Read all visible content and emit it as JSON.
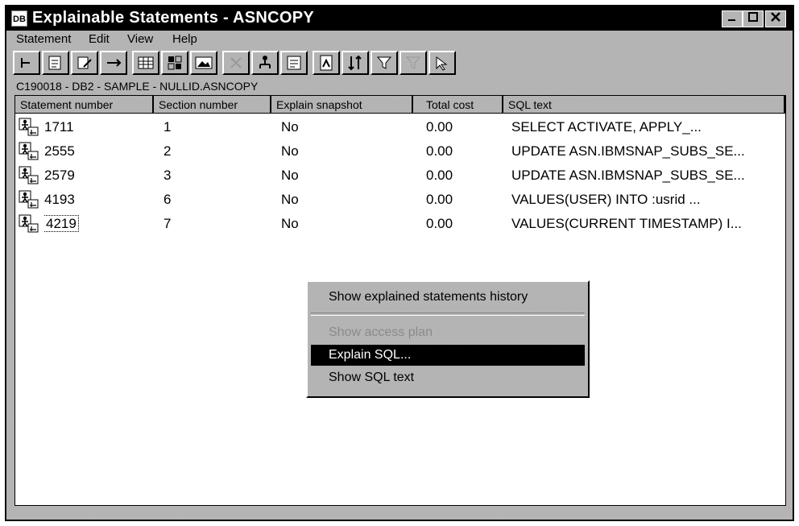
{
  "window": {
    "title": "Explainable Statements - ASNCOPY",
    "icon_label": "DB",
    "controls": [
      "minimize-icon",
      "maximize-icon",
      "close-icon"
    ]
  },
  "menubar": {
    "items": [
      {
        "label": "Statement",
        "mnemonic": "S"
      },
      {
        "label": "Edit",
        "mnemonic": "E"
      },
      {
        "label": "View",
        "mnemonic": "V"
      },
      {
        "label": "Help",
        "mnemonic": "H"
      }
    ]
  },
  "toolbar": {
    "buttons": [
      "refresh-icon",
      "explain-icon",
      "edit-icon",
      "arrows-icon",
      "grid-icon",
      "table-icon",
      "image-icon",
      "dim-tools-icon",
      "tree-icon",
      "sql-icon",
      "graph-icon",
      "sort-icon",
      "filter-icon",
      "dim-filter-icon",
      "help-icon"
    ]
  },
  "status_path": "C190018 - DB2 - SAMPLE - NULLID.ASNCOPY",
  "table": {
    "columns": [
      "Statement number",
      "Section number",
      "Explain snapshot",
      "Total cost",
      "SQL text"
    ],
    "rows": [
      {
        "statement": "1711",
        "section": "1",
        "snapshot": "No",
        "cost": "0.00",
        "sql": "SELECT    ACTIVATE,    APPLY_..."
      },
      {
        "statement": "2555",
        "section": "2",
        "snapshot": "No",
        "cost": "0.00",
        "sql": "UPDATE ASN.IBMSNAP_SUBS_SE..."
      },
      {
        "statement": "2579",
        "section": "3",
        "snapshot": "No",
        "cost": "0.00",
        "sql": "UPDATE ASN.IBMSNAP_SUBS_SE..."
      },
      {
        "statement": "4193",
        "section": "6",
        "snapshot": "No",
        "cost": "0.00",
        "sql": "VALUES(USER) INTO :usrid       ..."
      },
      {
        "statement": "4219",
        "section": "7",
        "snapshot": "No",
        "cost": "0.00",
        "sql": "VALUES(CURRENT TIMESTAMP) I..."
      }
    ]
  },
  "context_menu": {
    "items": [
      {
        "label": "Show explained statements history",
        "state": "enabled"
      },
      {
        "label": "Show access plan",
        "state": "disabled"
      },
      {
        "label": "Explain SQL...",
        "state": "selected"
      },
      {
        "label": "Show SQL text",
        "state": "enabled"
      }
    ]
  },
  "colors": {
    "titlebar": "#000000",
    "selection": "#000000",
    "chrome": "#c6c6c6",
    "list_background": "#ffffff"
  }
}
